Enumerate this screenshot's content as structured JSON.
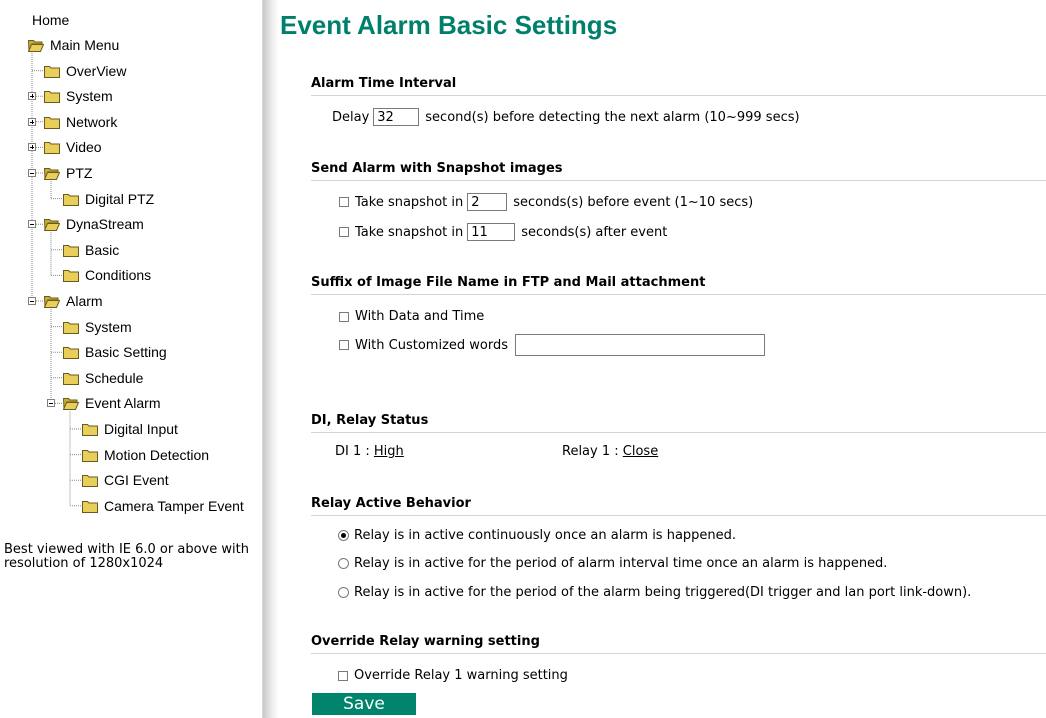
{
  "sidebar": {
    "home": "Home",
    "tree": [
      {
        "name": "main-menu",
        "label": "Main Menu",
        "expander": ""
      },
      {
        "name": "overview",
        "label": "OverView",
        "expander": ""
      },
      {
        "name": "system",
        "label": "System",
        "expander": "plus"
      },
      {
        "name": "network",
        "label": "Network",
        "expander": "plus"
      },
      {
        "name": "video",
        "label": "Video",
        "expander": "plus"
      },
      {
        "name": "ptz",
        "label": "PTZ",
        "expander": "minus"
      },
      {
        "name": "digital-ptz",
        "label": "Digital PTZ",
        "expander": ""
      },
      {
        "name": "dynastream",
        "label": "DynaStream",
        "expander": "minus"
      },
      {
        "name": "basic",
        "label": "Basic",
        "expander": ""
      },
      {
        "name": "conditions",
        "label": "Conditions",
        "expander": ""
      },
      {
        "name": "alarm",
        "label": "Alarm",
        "expander": "minus"
      },
      {
        "name": "alarm-system",
        "label": "System",
        "expander": ""
      },
      {
        "name": "basic-setting",
        "label": "Basic Setting",
        "expander": ""
      },
      {
        "name": "schedule",
        "label": "Schedule",
        "expander": ""
      },
      {
        "name": "event-alarm",
        "label": "Event Alarm",
        "expander": "minus"
      },
      {
        "name": "digital-input",
        "label": "Digital Input",
        "expander": ""
      },
      {
        "name": "motion-detection",
        "label": "Motion Detection",
        "expander": ""
      },
      {
        "name": "cgi-event",
        "label": "CGI Event",
        "expander": ""
      },
      {
        "name": "camera-tamper-event",
        "label": "Camera Tamper Event",
        "expander": ""
      }
    ],
    "note": "Best viewed with IE 6.0 or above with resolution of 1280x1024"
  },
  "main": {
    "title": "Event Alarm Basic Settings",
    "alarm_time": {
      "heading": "Alarm Time Interval",
      "delay_label": "Delay",
      "delay_value": "32",
      "delay_suffix": "second(s) before detecting the next alarm (10~999 secs)"
    },
    "snapshot": {
      "heading": "Send Alarm with Snapshot images",
      "before_label": "Take snapshot in",
      "before_value": "2",
      "before_suffix": "seconds(s) before event (1~10 secs)",
      "after_label": "Take snapshot in",
      "after_value": "11",
      "after_suffix": "seconds(s) after event"
    },
    "suffix": {
      "heading": "Suffix of Image File Name in FTP and Mail attachment",
      "date_time_label": "With Data and Time",
      "custom_label": "With Customized words",
      "custom_value": ""
    },
    "di_relay": {
      "heading": "DI, Relay Status",
      "di_label": "DI 1 : ",
      "di_value": "High",
      "relay_label": "Relay 1 : ",
      "relay_value": "Close"
    },
    "relay_behavior": {
      "heading": "Relay Active Behavior",
      "options": [
        "Relay is in active continuously once an alarm is happened.",
        "Relay is in active for the period of alarm interval time once an alarm is happened.",
        "Relay is in active for the period of the alarm being triggered(DI trigger and lan port link-down)."
      ],
      "selected_index": 0
    },
    "override": {
      "heading": "Override Relay warning setting",
      "option_label": "Override Relay 1 warning setting"
    },
    "save_label": "Save"
  },
  "colors": {
    "title": "#00806b",
    "save_button": "#00846c",
    "folder": "#e8cf5a"
  },
  "icons": {
    "folder": "folder-icon",
    "open_folder": "open-folder-icon",
    "expander_plus": "plus-box-icon",
    "expander_minus": "minus-box-icon"
  }
}
